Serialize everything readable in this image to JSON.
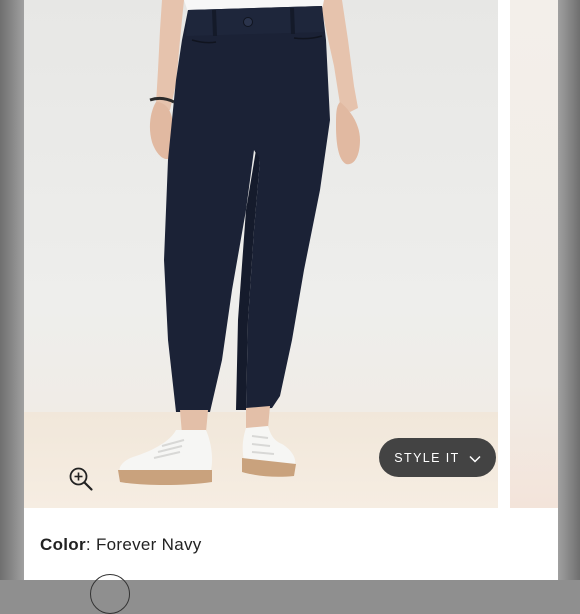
{
  "product_image": {
    "alt": "",
    "zoom_icon": "zoom-in-icon",
    "style_button": {
      "label": "STYLE IT",
      "icon": "chevron-down-icon",
      "background": "#434343"
    }
  },
  "color_selector": {
    "key": "Color",
    "separator": ": ",
    "value": "Forever Navy",
    "swatch_color": "#1b2236"
  }
}
